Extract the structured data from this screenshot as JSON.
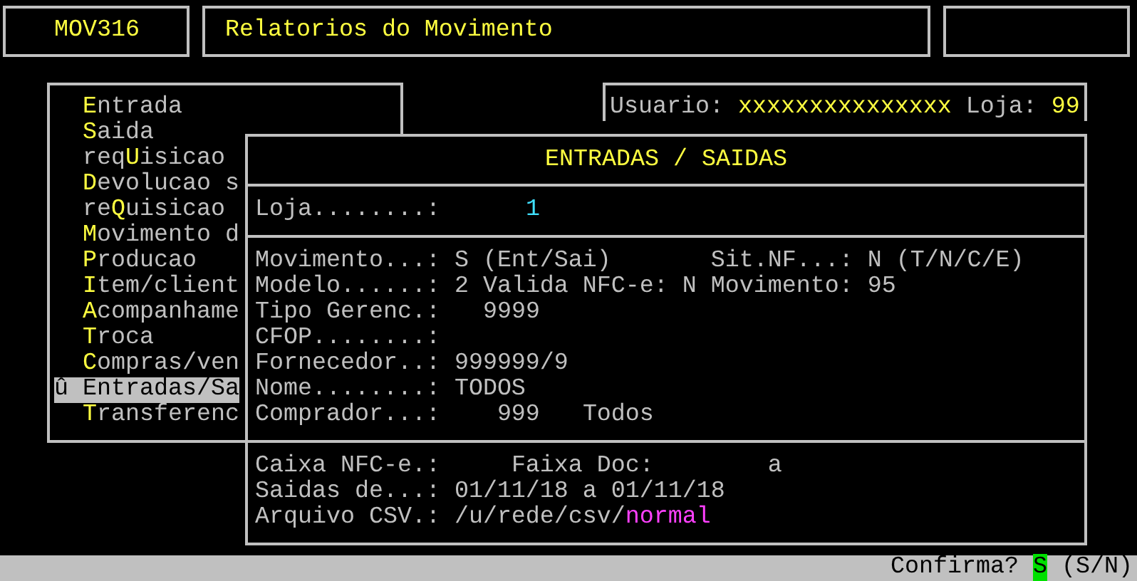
{
  "header": {
    "program_code": "MOV316",
    "title": "Relatorios do Movimento"
  },
  "menu": {
    "items": [
      {
        "hotkey": "E",
        "rest": "ntrada",
        "selected": false
      },
      {
        "hotkey": "S",
        "rest": "aida",
        "selected": false
      },
      {
        "prefix": "req",
        "hotkey": "U",
        "rest": "isicao",
        "selected": false
      },
      {
        "hotkey": "D",
        "rest": "evolucao s",
        "selected": false
      },
      {
        "prefix": "re",
        "hotkey": "Q",
        "rest": "uisicao",
        "selected": false
      },
      {
        "hotkey": "M",
        "rest": "ovimento d",
        "selected": false
      },
      {
        "hotkey": "P",
        "rest": "roducao",
        "selected": false
      },
      {
        "hotkey": "I",
        "rest": "tem/client",
        "selected": false
      },
      {
        "hotkey": "A",
        "rest": "companhame",
        "selected": false
      },
      {
        "hotkey": "T",
        "rest": "roca",
        "selected": false
      },
      {
        "hotkey": "C",
        "rest": "ompras/ven",
        "selected": false
      },
      {
        "marker": "û",
        "rest": "Entradas/Sa",
        "selected": true
      },
      {
        "hotkey": "T",
        "rest": "ransferenc",
        "selected": false
      }
    ]
  },
  "session": {
    "user_label": "Usuario:",
    "user": "xxxxxxxxxxxxxxx",
    "store_label": "Loja:",
    "store": "99"
  },
  "dialog": {
    "title": "ENTRADAS / SAIDAS",
    "sections": [
      [
        [
          {
            "text": "Loja........:"
          },
          {
            "text": "      1",
            "color": "#40e0ff"
          }
        ]
      ],
      [
        [
          {
            "text": "Movimento...:"
          },
          {
            "text": " S (Ent/Sai)"
          },
          {
            "text": "       Sit.NF...:"
          },
          {
            "text": " N (T/N/C/E)"
          }
        ],
        [
          {
            "text": "Modelo......:"
          },
          {
            "text": " 2"
          },
          {
            "text": " Valida NFC-e:"
          },
          {
            "text": " N"
          },
          {
            "text": " Movimento:"
          },
          {
            "text": " 95"
          }
        ],
        [
          {
            "text": "Tipo Gerenc.:"
          },
          {
            "text": "   9999"
          }
        ],
        [
          {
            "text": "CFOP........:"
          }
        ],
        [
          {
            "text": "Fornecedor..:"
          },
          {
            "text": " 999999/9"
          }
        ],
        [
          {
            "text": "Nome........:"
          },
          {
            "text": " TODOS"
          }
        ],
        [
          {
            "text": "Comprador...:"
          },
          {
            "text": "    999"
          },
          {
            "text": "   Todos"
          }
        ]
      ],
      [
        [
          {
            "text": "Caixa NFC-e.:"
          },
          {
            "text": "     Faixa Doc:"
          },
          {
            "text": "        a"
          }
        ],
        [
          {
            "text": "Saidas de...:"
          },
          {
            "text": " 01/11/18"
          },
          {
            "text": " a"
          },
          {
            "text": " 01/11/18"
          }
        ],
        [
          {
            "text": "Arquivo CSV.:"
          },
          {
            "text": " /u/rede/csv/"
          },
          {
            "text": "normal",
            "color": "#ff40ff"
          }
        ]
      ]
    ]
  },
  "status_bar": {
    "prompt": "Confirma?",
    "answer": "S",
    "options": "(S/N)"
  }
}
